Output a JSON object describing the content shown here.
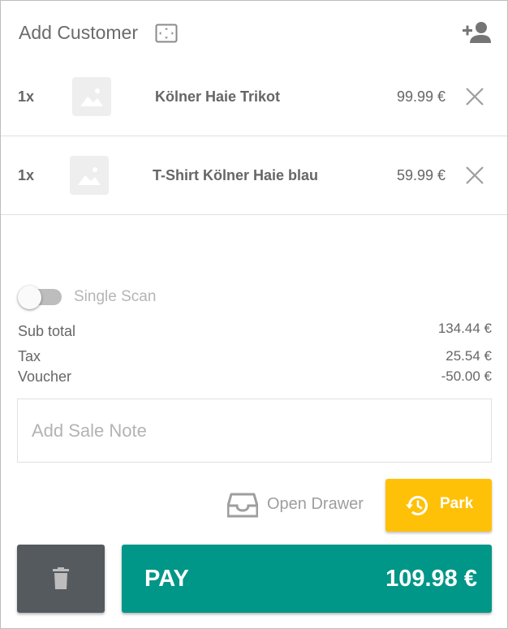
{
  "header": {
    "add_customer_label": "Add Customer",
    "expand_icon": "expand-icon",
    "add_person_icon": "person-add-icon"
  },
  "cart": {
    "items": [
      {
        "qty": "1x",
        "name": "Kölner Haie Trikot",
        "price": "99.99 €",
        "thumbnail_icon": "image-placeholder-icon",
        "remove_icon": "close-icon"
      },
      {
        "qty": "1x",
        "name": "T-Shirt Kölner Haie blau",
        "price": "59.99 €",
        "thumbnail_icon": "image-placeholder-icon",
        "remove_icon": "close-icon"
      }
    ]
  },
  "scan": {
    "label": "Single Scan",
    "enabled": false
  },
  "summary": {
    "subtotal_label": "Sub total",
    "subtotal_value": "134.44 €",
    "tax_label": "Tax",
    "tax_value": "25.54 €",
    "voucher_label": "Voucher",
    "voucher_value": "-50.00 €"
  },
  "note": {
    "placeholder": "Add Sale Note"
  },
  "actions": {
    "open_drawer_label": "Open Drawer",
    "park_label": "Park",
    "pay_label": "PAY",
    "pay_total": "109.98 €"
  },
  "colors": {
    "park": "#ffc107",
    "pay": "#009688",
    "trash": "#555a5e"
  }
}
